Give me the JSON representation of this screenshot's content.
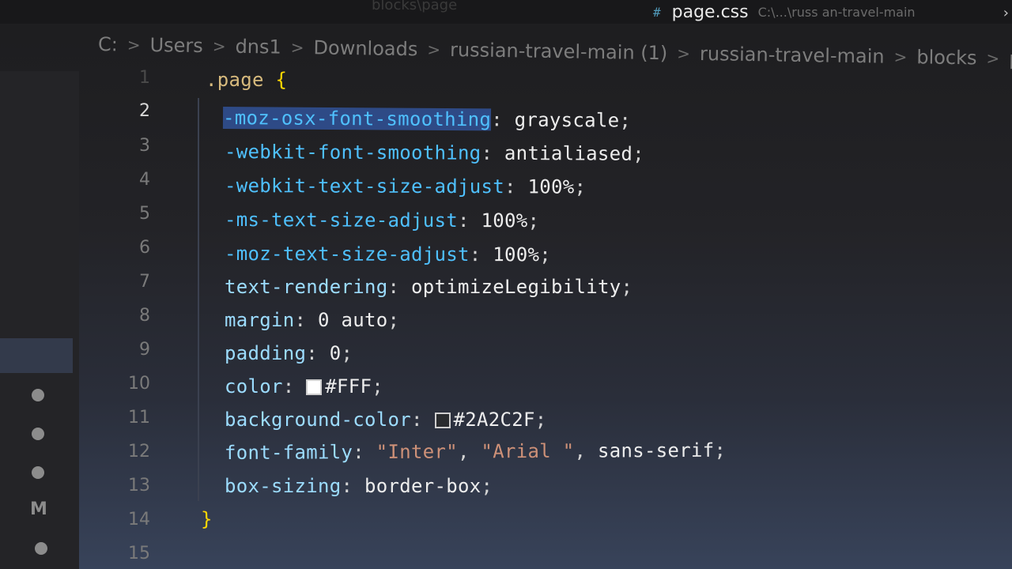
{
  "tabs": {
    "faded_label": "blocks\\page",
    "active_icon": "#",
    "active_label": "page.css",
    "active_path": "C:\\...\\russ an-travel-main",
    "close_glyph": "›"
  },
  "breadcrumb": [
    "C:",
    "Users",
    "dns1",
    "Downloads",
    "russian-travel-main (1)",
    "russian-travel-main",
    "blocks",
    "pa"
  ],
  "breadcrumb_separator": ">",
  "activity": {
    "badge_label": "M"
  },
  "editor": {
    "active_line": 2,
    "line_numbers": [
      "1",
      "2",
      "3",
      "4",
      "5",
      "6",
      "7",
      "8",
      "9",
      "10",
      "11",
      "12",
      "13",
      "14",
      "15"
    ],
    "lines": [
      {
        "selector": ".page",
        "brace": "{"
      },
      {
        "prop": "-moz-osx-font-smoothing",
        "colon": ":",
        "value": " grayscale",
        "semi": ";"
      },
      {
        "prop": "-webkit-font-smoothing",
        "colon": ":",
        "value": " antialiased",
        "semi": ";"
      },
      {
        "prop": "-webkit-text-size-adjust",
        "colon": ":",
        "value": " 100%",
        "semi": ";"
      },
      {
        "prop": "-ms-text-size-adjust",
        "colon": ":",
        "value": " 100%",
        "semi": ";"
      },
      {
        "prop": "-moz-text-size-adjust",
        "colon": ":",
        "value": " 100%",
        "semi": ";"
      },
      {
        "prop": "text-rendering",
        "colon": ":",
        "value": " optimizeLegibility",
        "semi": ";"
      },
      {
        "prop": "margin",
        "colon": ":",
        "value": " 0 auto",
        "semi": ";"
      },
      {
        "prop": "padding",
        "colon": ":",
        "value": " 0",
        "semi": ";"
      },
      {
        "prop": "color",
        "colon": ":",
        "value": "#FFF",
        "semi": ";",
        "swatch": "#FFFFFF"
      },
      {
        "prop": "background-color",
        "colon": ":",
        "value": "#2A2C2F",
        "semi": ";",
        "swatch": "#2A2C2F"
      },
      {
        "prop": "font-family",
        "colon": ":",
        "str1": "\"Inter\"",
        "comma1": ", ",
        "str2": "\"Arial \"",
        "comma2": ", ",
        "value": "sans-serif",
        "semi": ";"
      },
      {
        "prop": "box-sizing",
        "colon": ":",
        "value": " border-box",
        "semi": ";"
      },
      {
        "brace": "}"
      },
      {}
    ]
  }
}
